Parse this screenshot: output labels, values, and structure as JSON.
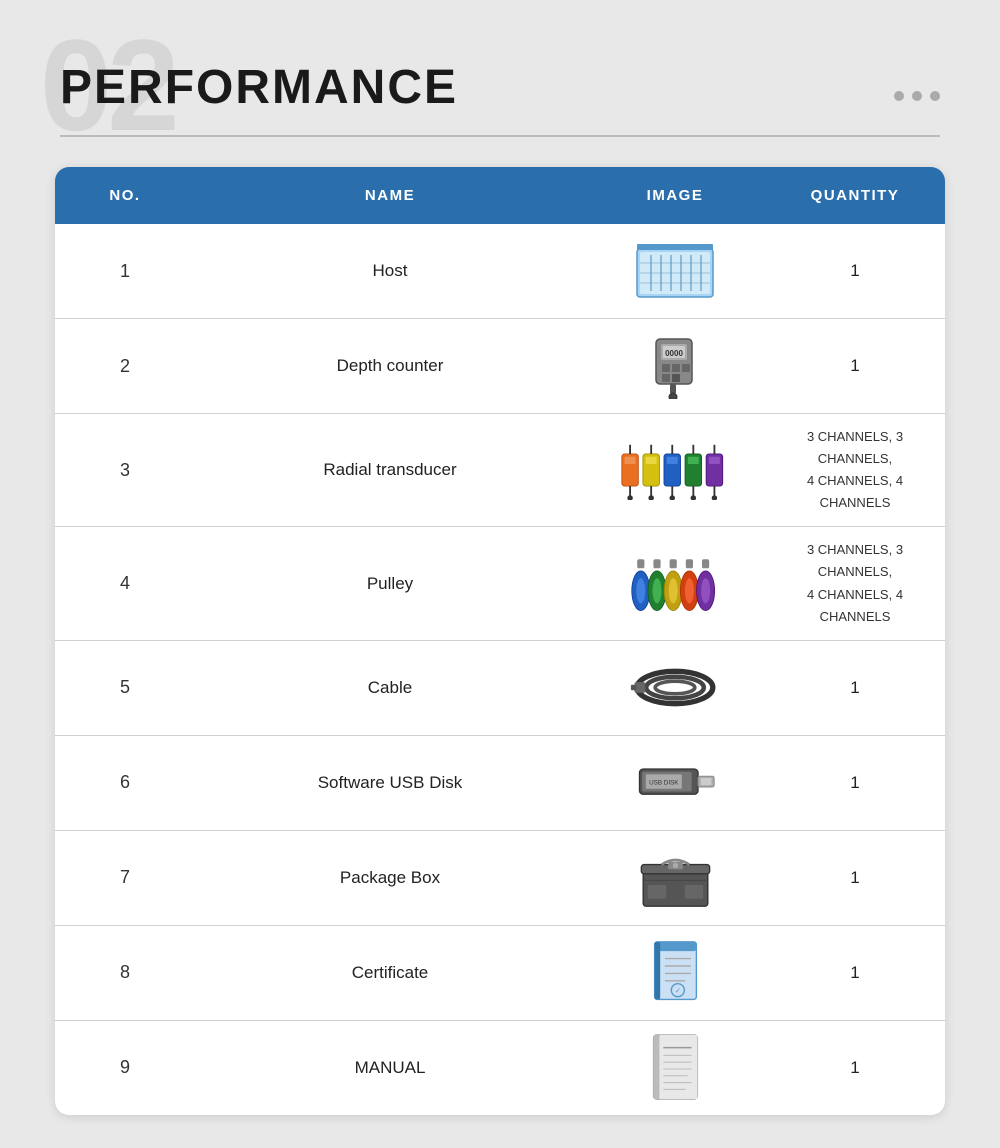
{
  "background_number": "02",
  "header": {
    "title": "PERFORMANCE"
  },
  "dots": [
    "•",
    "•",
    "•"
  ],
  "table": {
    "columns": [
      "NO.",
      "NAME",
      "IMAGE",
      "QUANTITY"
    ],
    "rows": [
      {
        "no": "1",
        "name": "Host",
        "quantity": "1",
        "quantity_type": "single"
      },
      {
        "no": "2",
        "name": "Depth counter",
        "quantity": "1",
        "quantity_type": "single"
      },
      {
        "no": "3",
        "name": "Radial transducer",
        "quantity": "3 CHANNELS, 3 CHANNELS,\n4 CHANNELS, 4 CHANNELS",
        "quantity_type": "multi"
      },
      {
        "no": "4",
        "name": "Pulley",
        "quantity": "3 CHANNELS, 3 CHANNELS,\n4 CHANNELS, 4 CHANNELS",
        "quantity_type": "multi"
      },
      {
        "no": "5",
        "name": "Cable",
        "quantity": "1",
        "quantity_type": "single"
      },
      {
        "no": "6",
        "name": "Software USB Disk",
        "quantity": "1",
        "quantity_type": "single"
      },
      {
        "no": "7",
        "name": "Package Box",
        "quantity": "1",
        "quantity_type": "single"
      },
      {
        "no": "8",
        "name": "Certificate",
        "quantity": "1",
        "quantity_type": "single"
      },
      {
        "no": "9",
        "name": "MANUAL",
        "quantity": "1",
        "quantity_type": "single"
      }
    ]
  }
}
